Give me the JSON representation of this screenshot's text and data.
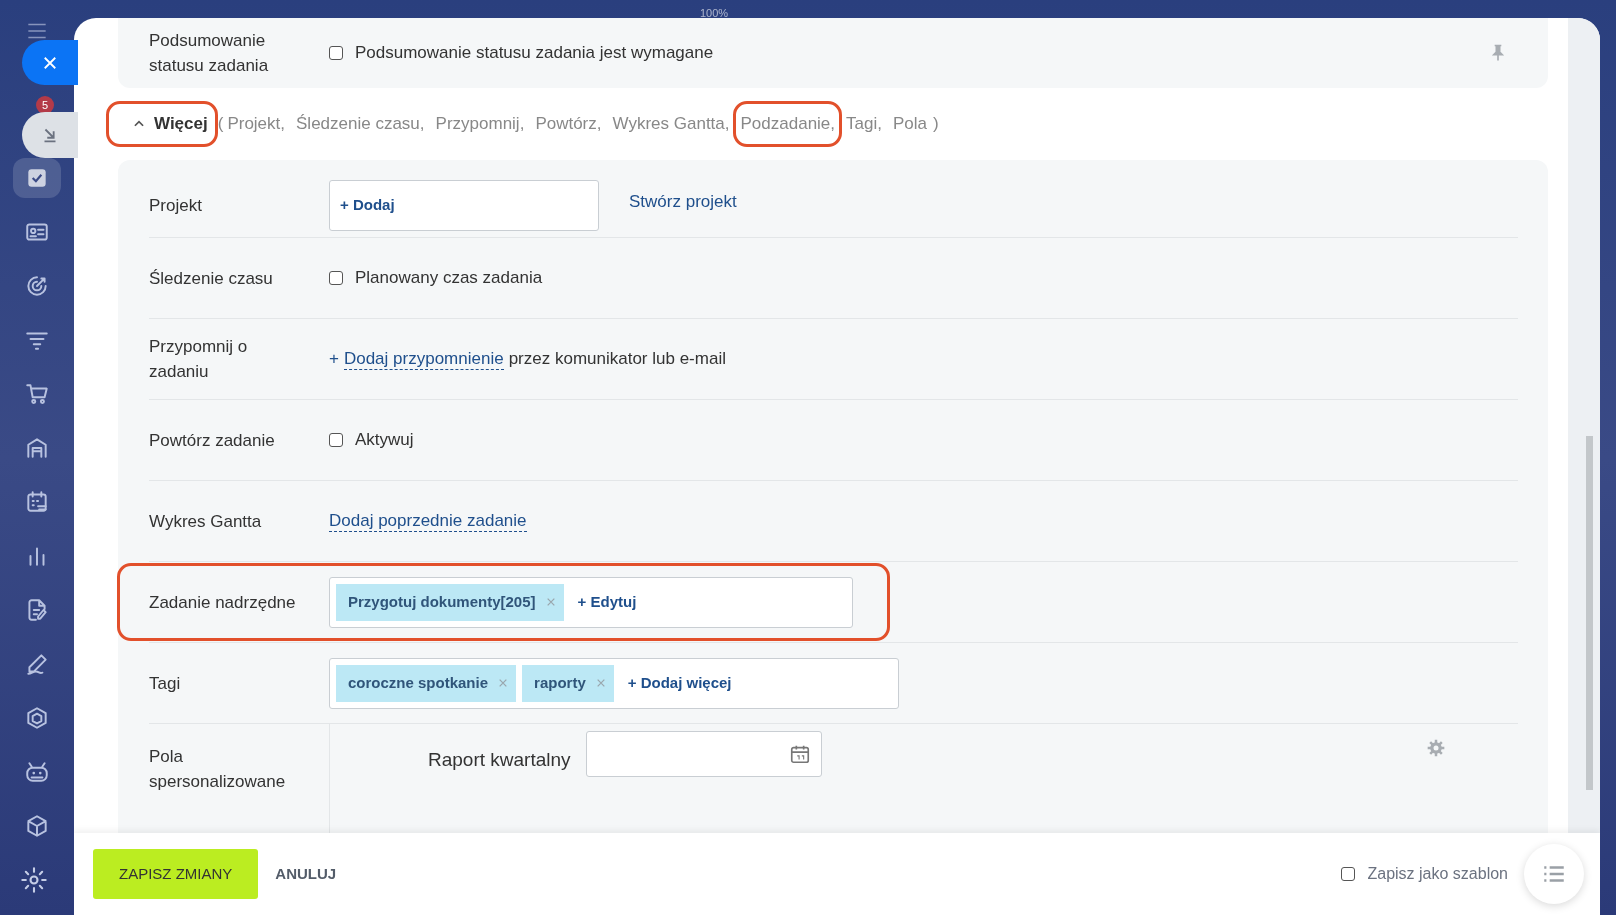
{
  "top_bar": {
    "zoom": "100%"
  },
  "sidebar": {
    "badge": "5",
    "items": [
      {
        "kind": "tasks",
        "selected": true
      },
      {
        "kind": "contact-card",
        "selected": false
      },
      {
        "kind": "target",
        "selected": false
      },
      {
        "kind": "funnel",
        "selected": false
      },
      {
        "kind": "cart",
        "selected": false
      },
      {
        "kind": "warehouse",
        "selected": false
      },
      {
        "kind": "calendar",
        "selected": false
      },
      {
        "kind": "bars",
        "selected": false
      },
      {
        "kind": "document",
        "selected": false
      },
      {
        "kind": "pencil",
        "selected": false
      },
      {
        "kind": "hexagon",
        "selected": false
      },
      {
        "kind": "robot",
        "selected": false
      },
      {
        "kind": "box",
        "selected": false
      }
    ]
  },
  "summary": {
    "label": "Podsumowanie statusu zadania",
    "checkbox": {
      "label": "Podsumowanie statusu zadania jest wymagane",
      "checked": false
    }
  },
  "more": {
    "label": "Więcej",
    "expanded": true,
    "highlighted": true,
    "open": "(",
    "close": ")",
    "items": [
      {
        "label": "Projekt,",
        "highlighted": false
      },
      {
        "label": "Śledzenie czasu,",
        "highlighted": false
      },
      {
        "label": "Przypomnij,",
        "highlighted": false
      },
      {
        "label": "Powtórz,",
        "highlighted": false
      },
      {
        "label": "Wykres Gantta,",
        "highlighted": false
      },
      {
        "label": "Podzadanie,",
        "highlighted": true
      },
      {
        "label": "Tagi,",
        "highlighted": false
      },
      {
        "label": "Pola",
        "highlighted": false
      }
    ]
  },
  "fields": [
    {
      "kind": "selector",
      "label": "Projekt",
      "button": "+ Dodaj",
      "link": "Stwórz projekt",
      "highlighted": false
    },
    {
      "kind": "checkbox",
      "label": "Śledzenie czasu",
      "checkbox": "Planowany czas zadania",
      "checked": false,
      "highlighted": false
    },
    {
      "kind": "reminder",
      "label": "Przypomnij o zadaniu",
      "prefix": "+",
      "link": "Dodaj przypomnienie",
      "suffix": "przez komunikator lub e-mail",
      "highlighted": false
    },
    {
      "kind": "checkbox",
      "label": "Powtórz zadanie",
      "checkbox": "Aktywuj",
      "checked": false,
      "highlighted": false
    },
    {
      "kind": "link",
      "label": "Wykres Gantta",
      "link": "Dodaj poprzednie zadanie",
      "highlighted": false
    },
    {
      "kind": "tags",
      "label": "Zadanie nadrzędne",
      "tags": [
        "Przygotuj dokumenty[205]"
      ],
      "add": "+ Edytuj",
      "highlighted": true
    },
    {
      "kind": "tags",
      "label": "Tagi",
      "tags": [
        "coroczne spotkanie",
        "raporty"
      ],
      "add": "+ Dodaj więcej",
      "highlighted": false
    },
    {
      "kind": "custom",
      "label": "Pola spersonalizowane",
      "field": "Raport kwartalny",
      "highlighted": false
    }
  ],
  "footer": {
    "save": "ZAPISZ ZMIANY",
    "cancel": "ANULUJ",
    "template": {
      "label": "Zapisz jako szablon",
      "checked": false
    }
  }
}
